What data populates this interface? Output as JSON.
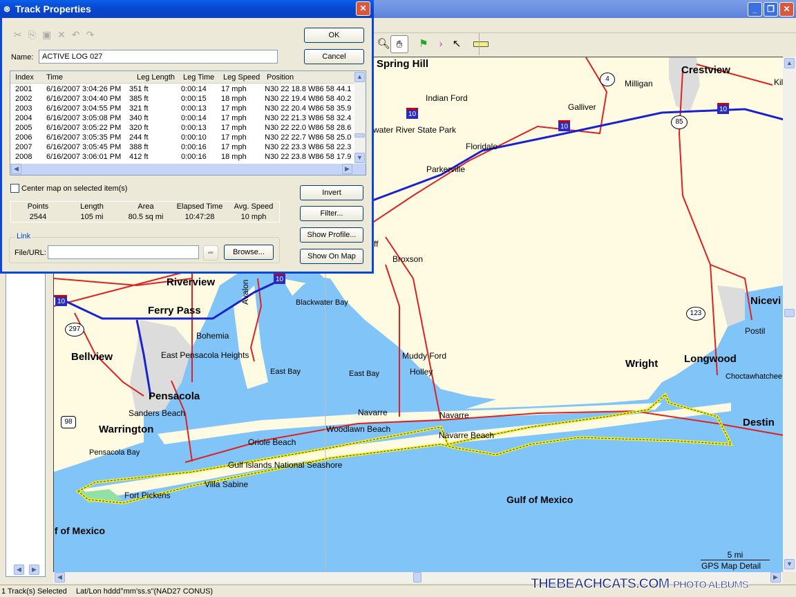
{
  "main_window": {
    "controls": [
      "minimize",
      "restore",
      "close"
    ]
  },
  "toolbar": {
    "tools": [
      {
        "icon": "zoom-icon"
      },
      {
        "icon": "hand-icon",
        "active": true
      },
      {
        "icon": "waypoint-flag-icon"
      },
      {
        "icon": "route-icon"
      },
      {
        "icon": "select-arrow-icon"
      },
      {
        "icon": "measure-ruler-icon"
      }
    ]
  },
  "dialog": {
    "title": "Track Properties",
    "edit_icons": [
      "cut-icon",
      "copy-icon",
      "paste-icon",
      "delete-icon",
      "undo-icon",
      "redo-icon"
    ],
    "name_label": "Name:",
    "name_value": "ACTIVE LOG 027",
    "ok": "OK",
    "cancel": "Cancel",
    "columns": [
      "Index",
      "Time",
      "Leg Length",
      "Leg Time",
      "Leg Speed",
      "Position"
    ],
    "rows": [
      [
        "2001",
        "6/16/2007 3:04:26 PM",
        "351 ft",
        "0:00:14",
        "17 mph",
        "N30 22 18.8 W86 58 44.1"
      ],
      [
        "2002",
        "6/16/2007 3:04:40 PM",
        "385 ft",
        "0:00:15",
        "18 mph",
        "N30 22 19.4 W86 58 40.2"
      ],
      [
        "2003",
        "6/16/2007 3:04:55 PM",
        "321 ft",
        "0:00:13",
        "17 mph",
        "N30 22 20.4 W86 58 35.9"
      ],
      [
        "2004",
        "6/16/2007 3:05:08 PM",
        "340 ft",
        "0:00:14",
        "17 mph",
        "N30 22 21.3 W86 58 32.4"
      ],
      [
        "2005",
        "6/16/2007 3:05:22 PM",
        "320 ft",
        "0:00:13",
        "17 mph",
        "N30 22 22.0 W86 58 28.6"
      ],
      [
        "2006",
        "6/16/2007 3:05:35 PM",
        "244 ft",
        "0:00:10",
        "17 mph",
        "N30 22 22.7 W86 58 25.0"
      ],
      [
        "2007",
        "6/16/2007 3:05:45 PM",
        "388 ft",
        "0:00:16",
        "17 mph",
        "N30 22 23.3 W86 58 22.3"
      ],
      [
        "2008",
        "6/16/2007 3:06:01 PM",
        "412 ft",
        "0:00:16",
        "18 mph",
        "N30 22 23.8 W86 58 17.9"
      ]
    ],
    "center_map_label": "Center map on selected item(s)",
    "center_map_checked": false,
    "stats_headers": [
      "Points",
      "Length",
      "Area",
      "Elapsed Time",
      "Avg. Speed"
    ],
    "stats_values": [
      "2544",
      "105 mi",
      "80.5 sq mi",
      "10:47:28",
      "10 mph"
    ],
    "invert": "Invert",
    "filter": "Filter...",
    "show_profile": "Show Profile...",
    "show_on_map": "Show On Map",
    "link_group": "Link",
    "file_url_label": "File/URL:",
    "file_url_value": "",
    "browse": "Browse..."
  },
  "map": {
    "labels": {
      "spring_hill": "Spring Hill",
      "crestview": "Crestview",
      "milligan": "Milligan",
      "kil": "Kil",
      "indian_ford": "Indian Ford",
      "galliver": "Galliver",
      "blackwater_park": "water River State Park",
      "floridale": "Floridale",
      "parkerville": "Parkerville",
      "broxson": "Broxson",
      "ff": "ff",
      "riverview": "Riverview",
      "avalon": "Avalon",
      "blackwater_bay": "Blackwater Bay",
      "ferry_pass": "Ferry Pass",
      "bohemia": "Bohemia",
      "bellview": "Bellview",
      "east_pensacola": "East Pensacola Heights",
      "east_bay1": "East Bay",
      "east_bay2": "East Bay",
      "muddy_ford": "Muddy Ford",
      "holley": "Holley",
      "pensacola": "Pensacola",
      "sanders_beach": "Sanders Beach",
      "warrington": "Warrington",
      "pensacola_bay": "Pensacola Bay",
      "navarre": "Navarre",
      "navarre2": "Navarre",
      "woodlawn": "Woodlawn Beach",
      "navarre_beach": "Navarre Beach",
      "oriole": "Oriole Beach",
      "gulf_islands": "Gulf Islands National Seashore",
      "villa_sabine": "Villa Sabine",
      "fort_pickens": "Fort Pickens",
      "gulf1": "Gulf of Mexico",
      "gulf2": "lf of Mexico",
      "wright": "Wright",
      "longwood": "Longwood",
      "niceville": "Nicevi",
      "postil": "Postil",
      "choctaw": "Choctawhatchee",
      "destin": "Destin"
    },
    "shields": {
      "i10": "10",
      "sr4": "4",
      "sr85": "85",
      "sr123": "123",
      "sr297": "297",
      "us98": "98"
    },
    "scale": "5 mi",
    "map_detail": "GPS Map Detail",
    "colors": {
      "land": "#fffbe3",
      "water": "#80c4f8",
      "interstate": "#1a22d0",
      "highway": "#e02020",
      "track": "#f0f020",
      "park": "#90e0a8",
      "urban": "#dcdcdc"
    }
  },
  "status": {
    "selection": "1 Track(s) Selected",
    "coords": "Lat/Lon hddd°mm'ss.s\"(NAD27 CONUS)"
  },
  "watermark": "TheBeachcats.com  Photo Albums"
}
